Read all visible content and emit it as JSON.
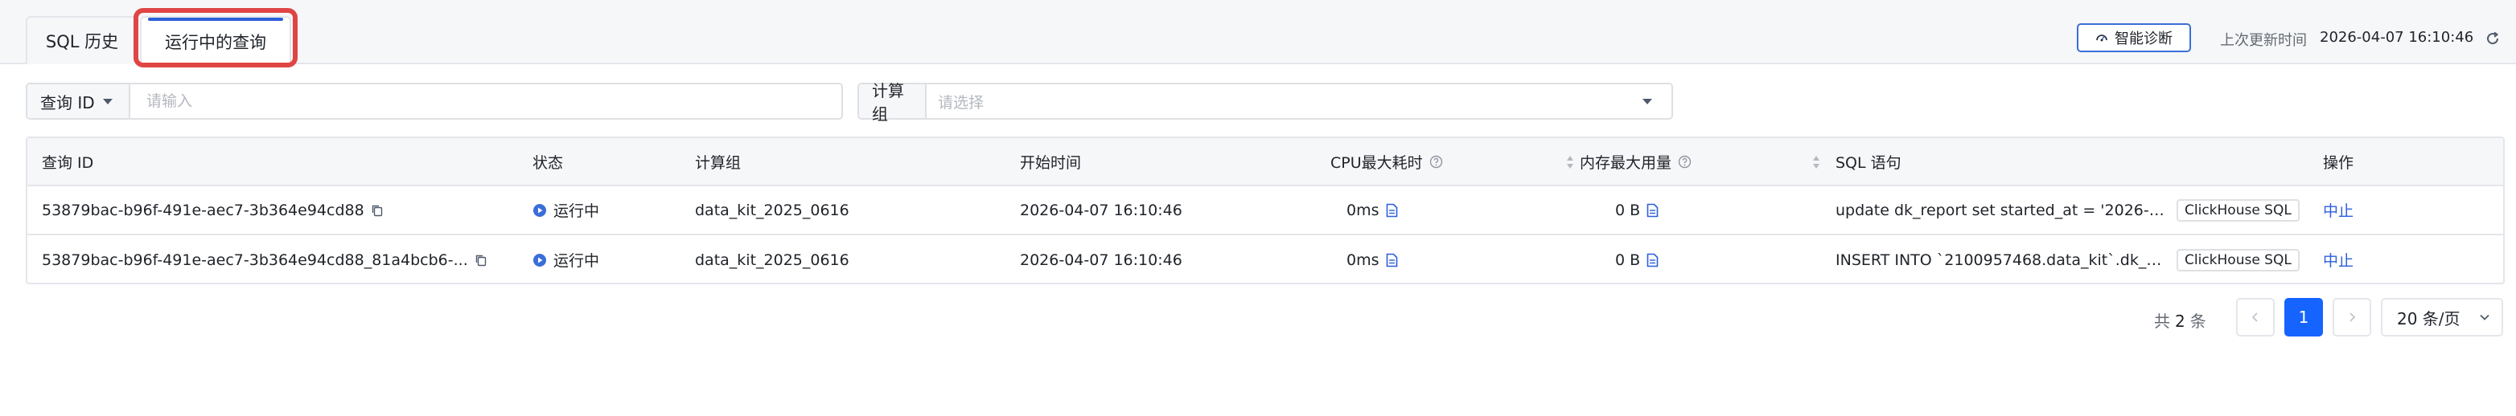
{
  "tabs": {
    "history": "SQL 历史",
    "running": "运行中的查询"
  },
  "header": {
    "diagnose_button": "智能诊断",
    "last_update_label": "上次更新时间",
    "last_update_time": "2026-04-07 16:10:46"
  },
  "filters": {
    "query_prefix": "查询 ID",
    "query_placeholder": "请输入",
    "group_prefix": "计算组",
    "group_placeholder": "请选择"
  },
  "table": {
    "columns": {
      "id": "查询 ID",
      "state": "状态",
      "group": "计算组",
      "start": "开始时间",
      "cpu": "CPU最大耗时",
      "mem": "内存最大用量",
      "sql": "SQL 语句",
      "op": "操作"
    },
    "rows": [
      {
        "id": "53879bac-b96f-491e-aec7-3b364e94cd88",
        "state": "运行中",
        "group": "data_kit_2025_0616",
        "start": "2026-04-07 16:10:46",
        "cpu": "0ms",
        "mem": "0 B",
        "sql": "update dk_report set started_at = '2026-0...",
        "sql_tag": "ClickHouse SQL",
        "op": "中止"
      },
      {
        "id": "53879bac-b96f-491e-aec7-3b364e94cd88_81a4bcb6-...",
        "state": "运行中",
        "group": "data_kit_2025_0616",
        "start": "2026-04-07 16:10:46",
        "cpu": "0ms",
        "mem": "0 B",
        "sql": "INSERT INTO `2100957468.data_kit`.dk_re...",
        "sql_tag": "ClickHouse SQL",
        "op": "中止"
      }
    ]
  },
  "pagination": {
    "total_prefix": "共",
    "total_count": "2",
    "total_suffix": "条",
    "current_page": "1",
    "page_size": "20 条/页"
  },
  "colors": {
    "accent": "#1664ff",
    "link": "#2c5fd9",
    "highlight_box": "#e04545",
    "running_state": "#3a6ed8"
  }
}
